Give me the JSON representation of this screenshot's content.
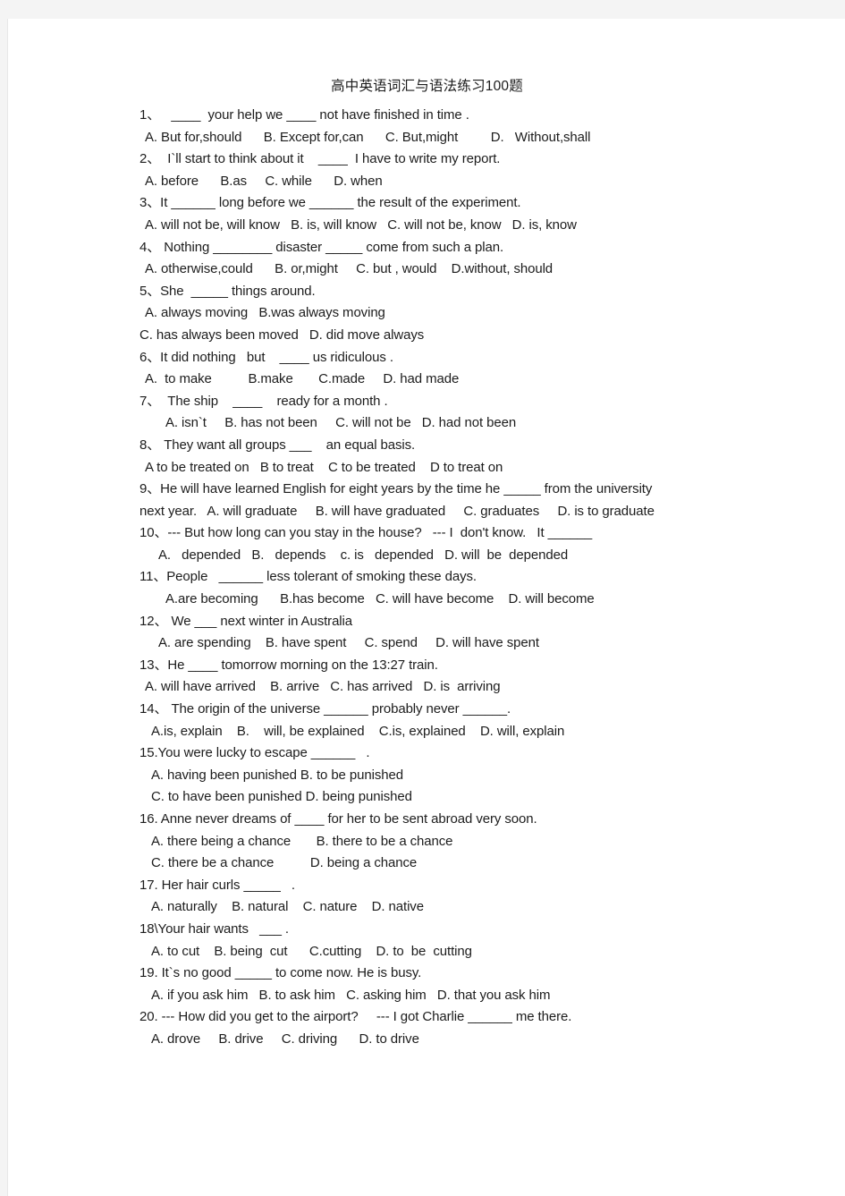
{
  "document": {
    "title": "高中英语词汇与语法练习100题",
    "page_background": "#ffffff",
    "text_color": "#1c1c1c",
    "outer_background": "#f4f4f4"
  },
  "lines": [
    {
      "id": "q1-stem",
      "indent": 0,
      "text": "1、   ____  your help we ____ not have finished in time ."
    },
    {
      "id": "q1-options",
      "indent": 1,
      "text": "A. But for,should      B. Except for,can      C. But,might         D.   Without,shall"
    },
    {
      "id": "q2-stem",
      "indent": 0,
      "text": "2、  I`ll start to think about it    ____  I have to write my report."
    },
    {
      "id": "q2-options",
      "indent": 1,
      "text": "A. before      B.as     C. while      D. when"
    },
    {
      "id": "q3-stem",
      "indent": 0,
      "text": "3、It ______ long before we ______ the result of the experiment."
    },
    {
      "id": "q3-options",
      "indent": 1,
      "text": "A. will not be, will know   B. is, will know   C. will not be, know   D. is, know"
    },
    {
      "id": "q4-stem",
      "indent": 0,
      "text": "4、 Nothing ________ disaster _____ come from such a plan."
    },
    {
      "id": "q4-options",
      "indent": 1,
      "text": "A. otherwise,could      B. or,might     C. but , would    D.without, should"
    },
    {
      "id": "q5-stem",
      "indent": 0,
      "text": "5、She  _____ things around."
    },
    {
      "id": "q5-optionsA",
      "indent": 1,
      "text": "A. always moving   B.was always moving"
    },
    {
      "id": "q5-optionsC",
      "indent": 0,
      "text": "C. has always been moved   D. did move always"
    },
    {
      "id": "q6-stem",
      "indent": 0,
      "text": "6、It did nothing   but    ____ us ridiculous ."
    },
    {
      "id": "q6-options",
      "indent": 1,
      "text": "A.  to make          B.make       C.made     D. had made"
    },
    {
      "id": "q7-stem",
      "indent": 0,
      "text": "7、  The ship    ____    ready for a month ."
    },
    {
      "id": "q7-options",
      "indent": 4,
      "text": "A. isn`t     B. has not been     C. will not be   D. had not been"
    },
    {
      "id": "q8-stem",
      "indent": 0,
      "text": "8、 They want all groups ___    an equal basis."
    },
    {
      "id": "q8-options",
      "indent": 1,
      "text": "A to be treated on   B to treat    C to be treated    D to treat on"
    },
    {
      "id": "q9-stem",
      "indent": 0,
      "text": "9、He will have learned English for eight years by the time he _____ from the university"
    },
    {
      "id": "q9-options",
      "indent": 0,
      "text": "next year.   A. will graduate     B. will have graduated     C. graduates     D. is to graduate"
    },
    {
      "id": "q10-stem",
      "indent": 0,
      "text": "10、--- But how long can you stay in the house?   --- I  don't know.   It ______"
    },
    {
      "id": "q10-options",
      "indent": 3,
      "text": "A.   depended   B.   depends    c. is   depended   D. will  be  depended"
    },
    {
      "id": "q11-stem",
      "indent": 0,
      "text": "11、People   ______ less tolerant of smoking these days."
    },
    {
      "id": "q11-options",
      "indent": 4,
      "text": "A.are becoming      B.has become   C. will have become    D. will become"
    },
    {
      "id": "q12-stem",
      "indent": 0,
      "text": "12、 We ___ next winter in Australia"
    },
    {
      "id": "q12-options",
      "indent": 3,
      "text": "A. are spending    B. have spent     C. spend     D. will have spent"
    },
    {
      "id": "q13-stem",
      "indent": 0,
      "text": "13、He ____ tomorrow morning on the 13:27 train."
    },
    {
      "id": "q13-options",
      "indent": 1,
      "text": "A. will have arrived    B. arrive   C. has arrived   D. is  arriving"
    },
    {
      "id": "q14-stem",
      "indent": 0,
      "text": "14、 The origin of the universe ______ probably never ______."
    },
    {
      "id": "q14-options",
      "indent": 2,
      "text": "A.is, explain    B.    will, be explained    C.is, explained    D. will, explain"
    },
    {
      "id": "q15-stem",
      "indent": 0,
      "text": "15.You were lucky to escape ______   ."
    },
    {
      "id": "q15-optionsA",
      "indent": 2,
      "text": "A. having been punished B. to be punished"
    },
    {
      "id": "q15-optionsC",
      "indent": 2,
      "text": "C. to have been punished D. being punished"
    },
    {
      "id": "q16-stem",
      "indent": 0,
      "text": "16. Anne never dreams of ____ for her to be sent abroad very soon."
    },
    {
      "id": "q16-optionsA",
      "indent": 2,
      "text": "A. there being a chance       B. there to be a chance"
    },
    {
      "id": "q16-optionsC",
      "indent": 2,
      "text": "C. there be a chance          D. being a chance"
    },
    {
      "id": "q17-stem",
      "indent": 0,
      "text": "17. Her hair curls _____   ."
    },
    {
      "id": "q17-options",
      "indent": 2,
      "text": "A. naturally    B. natural    C. nature    D. native"
    },
    {
      "id": "q18-stem",
      "indent": 0,
      "text": "18\\Your hair wants   ___ ."
    },
    {
      "id": "q18-options",
      "indent": 2,
      "text": "A. to cut    B. being  cut      C.cutting    D. to  be  cutting"
    },
    {
      "id": "q19-stem",
      "indent": 0,
      "text": "19. It`s no good _____ to come now. He is busy."
    },
    {
      "id": "q19-options",
      "indent": 2,
      "text": "A. if you ask him   B. to ask him   C. asking him   D. that you ask him"
    },
    {
      "id": "q20-stem",
      "indent": 0,
      "text": "20. --- How did you get to the airport?     --- I got Charlie ______ me there."
    },
    {
      "id": "q20-options",
      "indent": 2,
      "text": "A. drove     B. drive     C. driving      D. to drive"
    }
  ]
}
